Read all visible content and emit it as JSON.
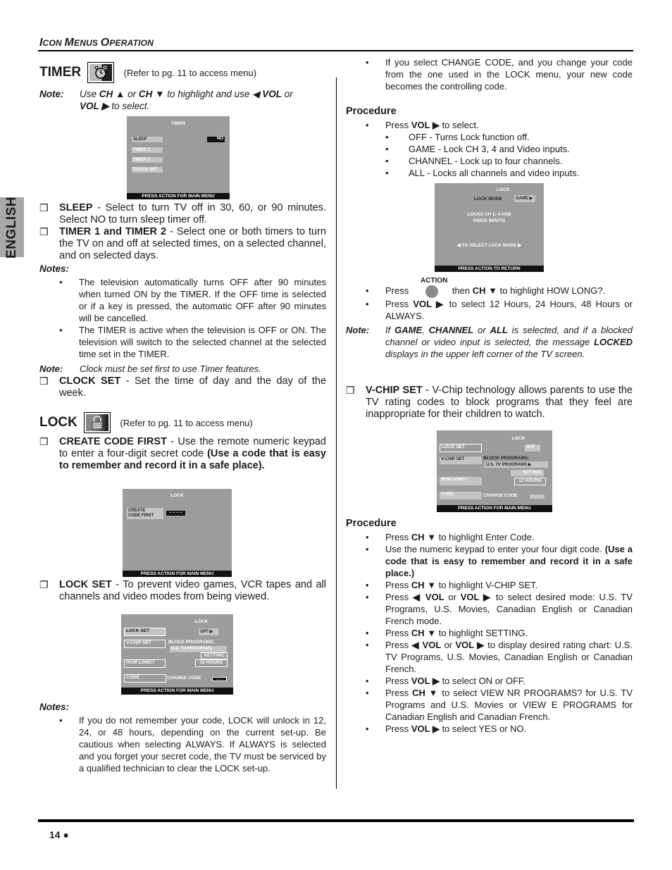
{
  "header": {
    "title_parts": [
      {
        "big": "I",
        "small": "CON "
      },
      {
        "big": "M",
        "small": "ENUS "
      },
      {
        "big": "O",
        "small": "PERATION"
      }
    ]
  },
  "language_tab": "ENGLISH",
  "footer": {
    "page_number": "14 ●"
  },
  "timer": {
    "heading": "TIMER",
    "icon": "alarm-clock-icon",
    "ref": "(Refer to pg. 11 to access menu)",
    "note_label": "Note:",
    "note_parts": [
      "Use ",
      "CH ▲",
      " or ",
      "CH ▼",
      " to highlight and use ◀ ",
      "VOL",
      " or ",
      "VOL ▶",
      "  to select."
    ],
    "osd": {
      "title": "TIMER",
      "items": [
        "SLEEP",
        "TIMER 1",
        "TIMER 2",
        "CLOCK SET"
      ],
      "sleep_value": "NO",
      "bar": "PRESS ACTION FOR MAIN MENU"
    },
    "items": [
      {
        "term": "SLEEP",
        "text": " - Select to turn TV off in 30, 60, or 90 minutes. Select NO to turn sleep timer off."
      },
      {
        "term": "TIMER 1 and TIMER 2",
        "text": " - Select one or both timers to turn the TV on and off at selected times, on a selected channel, and on selected days."
      }
    ],
    "notes_label": "Notes:",
    "notes": [
      "The television automatically turns OFF after 90 minutes when turned ON by the TIMER. If the OFF time is selected or if a key is pressed, the automatic OFF after 90 minutes will be cancelled.",
      "The TIMER is active when the television is OFF or ON. The television will switch to the selected channel at the selected time set in the TIMER."
    ],
    "note2_label": "Note:",
    "note2": "Clock must be set first to use Timer features.",
    "clock_set": {
      "term": "CLOCK SET",
      "text": " - Set the time of day and the day of the week."
    }
  },
  "lock": {
    "heading": "LOCK",
    "icon": "padlock-icon",
    "ref": "(Refer to pg. 11 to access menu)",
    "create_code": {
      "term": "CREATE CODE FIRST",
      "text": " - Use the remote numeric keypad to enter a four-digit secret code ",
      "bold_tail": "(Use a code that is easy to remember and record it in a safe place)."
    },
    "osd_create": {
      "title": "LOCK",
      "label_line1": "CREATE",
      "label_line2": "CODE FIRST",
      "code": "– – – –",
      "bar": "PRESS ACTION FOR MAIN MENU"
    },
    "lock_set": {
      "term": "LOCK SET",
      "text": " - To prevent video games, VCR tapes and all channels and video modes from being viewed."
    },
    "osd_lockset": {
      "title": "LOCK",
      "items": [
        "LOCK SET",
        "V-CHIP SET",
        "HOW LONG?",
        "CODE"
      ],
      "lock_value": "OFF ▶",
      "block_programs": "BLOCK PROGRAMS:",
      "program_type": "U.S.  TV  PROGRAMS",
      "setting": "SETTING:",
      "how_long_value": "12 HOURS",
      "change_code": "CHANGE CODE",
      "code_value": "- - - -",
      "bar": "PRESS ACTION FOR MAIN MENU"
    },
    "notes_label": "Notes:",
    "notes": [
      "If you do not remember your code, LOCK will unlock in 12, 24, or 48 hours, depending on the current set-up. Be cautious when selecting ALWAYS. If ALWAYS is selected and you forget your secret code, the TV must be serviced by a qualified technician to clear the LOCK set-up.",
      "If you select CHANGE CODE, and you change your code from the one used in the LOCK menu, your new code becomes the controlling code."
    ],
    "procedure_label": "Procedure",
    "procedure": {
      "press_vol": [
        "Press ",
        "VOL ▶",
        " to select."
      ],
      "modes": [
        "OFF - Turns Lock function off.",
        "GAME - Lock CH 3, 4 and Video inputs.",
        "CHANNEL - Lock up to four channels.",
        "ALL - Locks all channels and video inputs."
      ]
    },
    "osd_mode": {
      "title": "LOCK",
      "mode_label": "LOCK MODE",
      "mode_value": "GAME ▶",
      "desc_line1": "LOCKS  CH  3, 4  AND",
      "desc_line2": "VIDEO INPUTS",
      "hint": "◀ TO SELECT LOCK MODE ▶",
      "bar": "PRESS ACTION TO RETURN"
    },
    "action_label": "ACTION",
    "press_action": [
      "Press",
      "then ",
      "CH ▼",
      " to highlight HOW LONG?."
    ],
    "press_vol_hours": [
      "Press ",
      "VOL ▶",
      " to select 12 Hours, 24 Hours, 48 Hours or ALWAYS."
    ],
    "note_label": "Note:",
    "note_parts": [
      "If ",
      "GAME",
      ", ",
      "CHANNEL",
      " or ",
      "ALL",
      " is selected, and if a blocked channel or video input is selected, the message ",
      "LOCKED",
      " displays in the upper left corner of the TV screen."
    ]
  },
  "vchip": {
    "term": "V-CHIP SET",
    "text": " - V-Chip technology allows parents to use the TV rating codes to block programs that they feel are inappropriate for their children to watch.",
    "osd": {
      "title": "LOCK",
      "items": [
        "LOCK SET",
        "V-CHIP SET",
        "HOW LONG?",
        "CODE"
      ],
      "lock_value": "OFF",
      "block_programs": "BLOCK PROGRAMS:",
      "program_type": "U.S.  TV  PROGRAMS ▶",
      "setting": "SETTING:",
      "how_long_value": "12 HOURS",
      "change_code": "CHANGE CODE",
      "code_value": "- - - -",
      "bar": "PRESS ACTION FOR MAIN MENU"
    },
    "procedure_label": "Procedure",
    "steps": [
      [
        [
          "Press ",
          false
        ],
        [
          "CH  ▼",
          true
        ],
        [
          "  to highlight Enter Code.",
          false
        ]
      ],
      [
        [
          "Use the numeric keypad to enter your four digit code. ",
          false
        ],
        [
          "(Use a code that is easy to remember and record it in a safe place.)",
          true
        ]
      ],
      [
        [
          "Press ",
          false
        ],
        [
          "CH  ▼",
          true
        ],
        [
          " to highlight V-CHIP SET.",
          false
        ]
      ],
      [
        [
          "Press ",
          false
        ],
        [
          "◀  VOL",
          true
        ],
        [
          "  or  ",
          false
        ],
        [
          "VOL  ▶",
          true
        ],
        [
          "  to select desired mode: U.S. TV Programs, U.S. Movies, Canadian English or Canadian French mode.",
          false
        ]
      ],
      [
        [
          "Press ",
          false
        ],
        [
          "CH  ▼",
          true
        ],
        [
          " to highlight SETTING.",
          false
        ]
      ],
      [
        [
          "Press ",
          false
        ],
        [
          "◀  VOL",
          true
        ],
        [
          "  or ",
          false
        ],
        [
          "VOL  ▶",
          true
        ],
        [
          " to display desired rating chart: U.S. TV Programs, U.S. Movies, Canadian English or Canadian French.",
          false
        ]
      ],
      [
        [
          "Press ",
          false
        ],
        [
          "VOL  ▶",
          true
        ],
        [
          "  to select ON or OFF.",
          false
        ]
      ],
      [
        [
          "Press ",
          false
        ],
        [
          "CH  ▼",
          true
        ],
        [
          "  to select VIEW NR PROGRAMS? for U.S. TV Programs and U.S. Movies or VIEW E PROGRAMS for Canadian English and Canadian French.",
          false
        ]
      ],
      [
        [
          "Press ",
          false
        ],
        [
          "VOL  ▶",
          true
        ],
        [
          "  to select YES or NO.",
          false
        ]
      ]
    ]
  }
}
